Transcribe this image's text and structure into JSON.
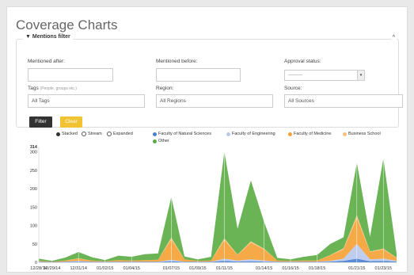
{
  "page": {
    "title": "Coverage Charts"
  },
  "filter": {
    "legend": "Mentions filter",
    "collapse_icon": "^",
    "mentioned_after": {
      "label": "Mentioned after:",
      "value": ""
    },
    "mentioned_before": {
      "label": "Mentioned before:",
      "value": ""
    },
    "approval_status": {
      "label": "Approval status:",
      "selected": "---------"
    },
    "tags": {
      "label": "Tags",
      "hint": "(People, groups etc.)",
      "value": "All Tags"
    },
    "region": {
      "label": "Region:",
      "value": "All Regions"
    },
    "source": {
      "label": "Source:",
      "value": "All Sources"
    },
    "filter_button": "Filter",
    "clear_button": "Clear"
  },
  "chart_controls": {
    "stacked": "Stacked",
    "stream": "Stream",
    "expanded": "Expanded",
    "selected": "Stacked"
  },
  "colors": {
    "natural_sciences": "#4a7fd0",
    "engineering": "#b8c9ec",
    "medicine": "#f5a133",
    "business": "#f7c17a",
    "other": "#5aac44"
  },
  "chart_data": {
    "type": "area",
    "stacked": true,
    "x": [
      "12/28/14",
      "12/29/14",
      "12/30/14",
      "12/31/14",
      "01/01/15",
      "01/02/15",
      "01/03/15",
      "01/04/15",
      "01/05/15",
      "01/06/15",
      "01/07/15",
      "01/08/15",
      "01/09/15",
      "01/10/15",
      "01/11/15",
      "01/12/15",
      "01/13/15",
      "01/14/15",
      "01/15/15",
      "01/16/15",
      "01/17/15",
      "01/18/15",
      "01/19/15",
      "01/20/15",
      "01/21/15",
      "01/22/15",
      "01/23/15",
      "01/24/15"
    ],
    "x_tick_labels": [
      "12/28/14",
      "12/29/14",
      "12/31/14",
      "01/02/15",
      "01/04/15",
      "01/07/15",
      "01/09/15",
      "01/11/15",
      "01/14/15",
      "01/16/15",
      "01/18/15",
      "01/21/15",
      "01/23/15"
    ],
    "y_tick_labels": [
      0,
      50,
      100,
      150,
      200,
      250,
      300,
      314
    ],
    "ylim": [
      0,
      314
    ],
    "series": [
      {
        "name": "Faculty of Natural Sciences",
        "values": [
          1,
          1,
          1,
          2,
          1,
          1,
          1,
          1,
          1,
          1,
          3,
          1,
          1,
          1,
          4,
          2,
          3,
          2,
          1,
          1,
          1,
          1,
          2,
          4,
          10,
          3,
          4,
          2
        ]
      },
      {
        "name": "Faculty of Engineering",
        "values": [
          1,
          0,
          1,
          2,
          1,
          1,
          1,
          1,
          1,
          1,
          4,
          1,
          1,
          1,
          6,
          3,
          5,
          3,
          1,
          1,
          1,
          1,
          2,
          6,
          40,
          5,
          6,
          2
        ]
      },
      {
        "name": "Faculty of Medicine",
        "values": [
          2,
          1,
          3,
          6,
          3,
          1,
          4,
          3,
          4,
          5,
          55,
          6,
          2,
          3,
          50,
          15,
          45,
          30,
          3,
          2,
          3,
          3,
          15,
          25,
          70,
          20,
          25,
          8
        ]
      },
      {
        "name": "Business School",
        "values": [
          0,
          0,
          0,
          1,
          0,
          0,
          0,
          0,
          0,
          0,
          5,
          0,
          0,
          0,
          5,
          1,
          4,
          2,
          0,
          0,
          0,
          0,
          1,
          3,
          8,
          2,
          2,
          1
        ]
      },
      {
        "name": "Other",
        "values": [
          6,
          2,
          8,
          17,
          9,
          3,
          12,
          10,
          16,
          17,
          110,
          8,
          4,
          10,
          235,
          70,
          165,
          73,
          7,
          4,
          10,
          15,
          30,
          30,
          142,
          40,
          245,
          10
        ]
      }
    ]
  }
}
